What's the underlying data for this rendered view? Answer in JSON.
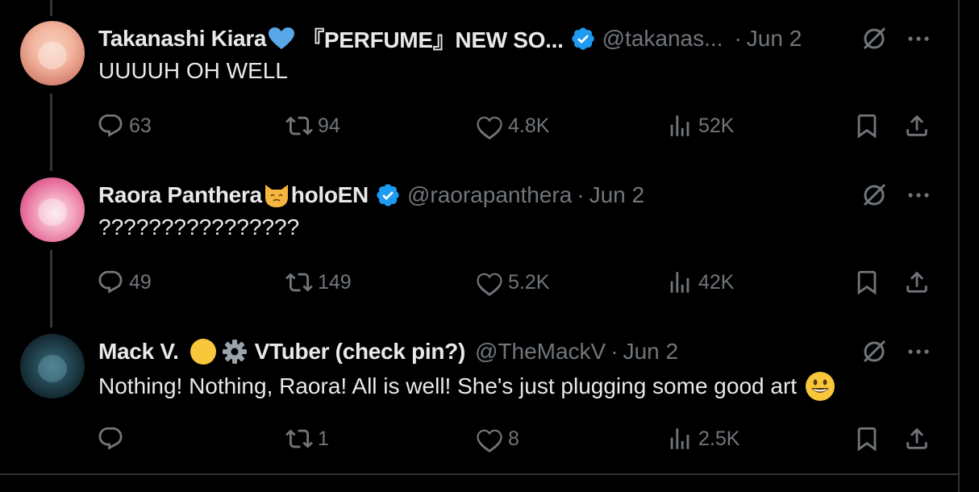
{
  "colors": {
    "background": "#000000",
    "text": "#e7e9ea",
    "muted": "#71767b",
    "verified_blue": "#1d9bf0",
    "divider": "#2f3336"
  },
  "tweets": [
    {
      "avatar": "avatar-kiara",
      "name_part1": "Takanashi Kiara",
      "name_emoji": "blue-heart-emoji",
      "name_part2": "『PERFUME』NEW SO...",
      "verified": true,
      "handle": "@takanas...",
      "separator": "·",
      "date": "Jun 2",
      "text": "UUUUH OH WELL",
      "replies": "63",
      "reposts": "94",
      "likes": "4.8K",
      "views": "52K"
    },
    {
      "avatar": "avatar-raora",
      "name_part1": "Raora Panthera",
      "name_emoji": "cat-face-emoji",
      "name_part2": "holoEN",
      "verified": true,
      "handle": "@raorapanthera",
      "separator": "·",
      "date": "Jun 2",
      "text": "????????????????",
      "replies": "49",
      "reposts": "149",
      "likes": "5.2K",
      "views": "42K"
    },
    {
      "avatar": "avatar-mack",
      "name_part1": "Mack V.",
      "name_emoji": "yellow-circle-gear-emoji",
      "name_part2": "VTuber (check pin?)",
      "verified": false,
      "handle": "@TheMackV",
      "separator": "·",
      "date": "Jun 2",
      "text": "Nothing! Nothing, Raora! All is well! She's just plugging some good art",
      "text_emoji": "smiling-face-emoji",
      "replies": "",
      "reposts": "1",
      "likes": "8",
      "views": "2.5K"
    }
  ]
}
